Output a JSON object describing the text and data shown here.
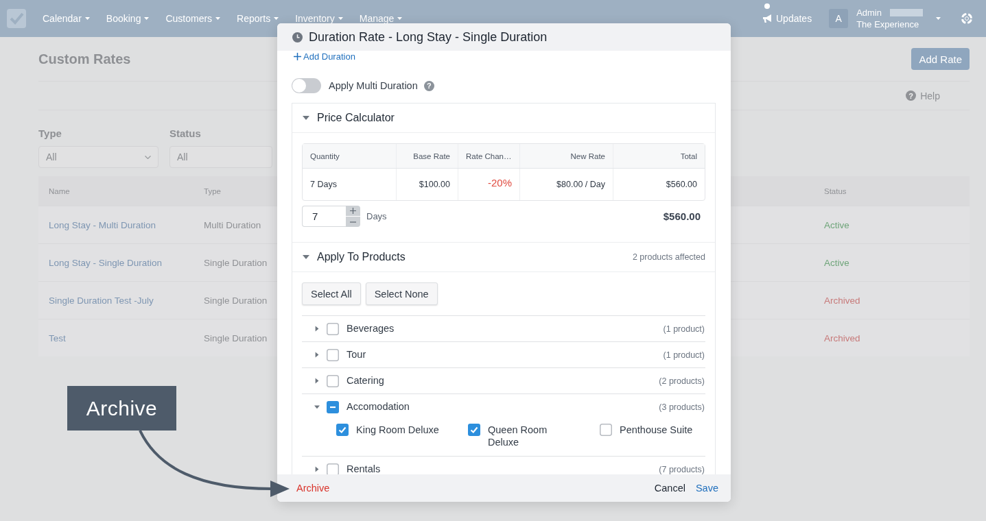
{
  "navbar": {
    "menu": [
      {
        "label": "Calendar"
      },
      {
        "label": "Booking"
      },
      {
        "label": "Customers"
      },
      {
        "label": "Reports"
      },
      {
        "label": "Inventory"
      },
      {
        "label": "Manage"
      }
    ],
    "updates": "Updates",
    "user": {
      "initial": "A",
      "name": "Admin",
      "account": "The Experience"
    }
  },
  "page": {
    "title": "Custom Rates",
    "add_button": "Add Rate",
    "help": {
      "icon": "?",
      "label": "Help"
    },
    "filters": [
      {
        "label": "Type",
        "value": "All"
      },
      {
        "label": "Status",
        "value": "All"
      }
    ],
    "table": {
      "columns": [
        "Name",
        "Type",
        "Status"
      ],
      "rows": [
        {
          "name": "Long Stay - Multi Duration",
          "type": "Multi Duration",
          "status": "Active",
          "color": "#6fa57a"
        },
        {
          "name": "Long Stay - Single Duration",
          "type": "Single Duration",
          "status": "Active",
          "color": "#6fa57a"
        },
        {
          "name": "Single Duration Test -July",
          "type": "Single Duration",
          "status": "Archived",
          "color": "#c77a7a"
        },
        {
          "name": "Test",
          "type": "Single Duration",
          "status": "Archived",
          "color": "#c77a7a"
        }
      ]
    }
  },
  "modal": {
    "title": "Duration Rate - Long Stay - Single Duration",
    "add_duration": "Add Duration",
    "multi_duration": {
      "label": "Apply Multi Duration",
      "on": false,
      "help_icon": "?"
    },
    "price_calculator": {
      "title": "Price Calculator",
      "expanded": true,
      "columns": [
        "Quantity",
        "Base Rate",
        "Rate Chan…",
        "New Rate",
        "Total"
      ],
      "rows": [
        {
          "quantity": "7 Days",
          "base_rate": "$100.00",
          "rate_change": "-20%",
          "new_rate": "$80.00 / Day",
          "total": "$560.00"
        }
      ],
      "stepper": {
        "value": "7",
        "unit": "Days"
      },
      "grand_total": "$560.00"
    },
    "products": {
      "title": "Apply To Products",
      "expanded": true,
      "summary": "2 products affected",
      "actions": [
        "Select All",
        "Select None"
      ],
      "categories": [
        {
          "name": "Beverages",
          "count": "(1 product)",
          "expanded": false,
          "checked": false,
          "partial": false
        },
        {
          "name": "Tour",
          "count": "(1 product)",
          "expanded": false,
          "checked": false,
          "partial": false
        },
        {
          "name": "Catering",
          "count": "(2 products)",
          "expanded": false,
          "checked": false,
          "partial": false
        },
        {
          "name": "Accomodation",
          "count": "(3 products)",
          "expanded": true,
          "checked": true,
          "partial": true,
          "children": [
            {
              "name": "King Room Deluxe",
              "checked": true
            },
            {
              "name": "Queen Room Deluxe",
              "checked": true
            },
            {
              "name": "Penthouse Suite",
              "checked": false
            }
          ]
        },
        {
          "name": "Rentals",
          "count": "(7 products)",
          "expanded": false,
          "checked": false,
          "partial": false
        }
      ]
    },
    "footer": [
      {
        "label": "Archive",
        "kind": "danger"
      },
      {
        "label": "Cancel",
        "kind": "secondary"
      },
      {
        "label": "Save",
        "kind": "primary"
      }
    ]
  },
  "callout": {
    "label": "Archive"
  }
}
